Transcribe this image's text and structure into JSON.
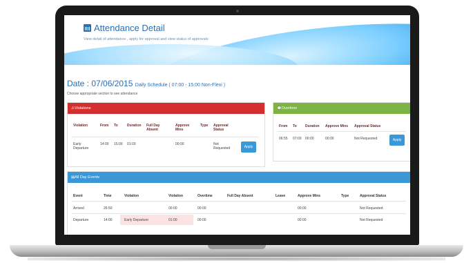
{
  "banner": {
    "title": "Attendance Detail",
    "subtitle": "View detail of attendance , apply for approval and view status of approvals"
  },
  "date": {
    "label": "Date : 07/06/2015",
    "schedule": "Daily Schedule ( 07:00 - 15:00 Non-Flexi )"
  },
  "hint": "Choose appropriate section to see attendance",
  "violations": {
    "title": "Violations",
    "header_color": "#d32f2f",
    "columns": [
      "Violation",
      "From",
      "To",
      "Duration",
      "Full Day Absent",
      "Approve Mins",
      "Type",
      "Approval Status"
    ],
    "row": {
      "violation": "Early Departure",
      "from": "14:00",
      "to": "15:00",
      "duration": "01:00",
      "full_day_absent": "",
      "approve_mins": "00:00",
      "type": "",
      "status": "Not Requested"
    },
    "apply_label": "Apply"
  },
  "overtime": {
    "title": "Overtime",
    "header_color": "#7cb342",
    "columns": [
      "From",
      "To",
      "Duration",
      "Approve Mins",
      "Approval Status"
    ],
    "row": {
      "from": "06:55",
      "to": "07:00",
      "duration": "00:00",
      "approve_mins": "00:00",
      "status": "Not Requested"
    },
    "apply_label": "Apply"
  },
  "all_day": {
    "title": "All Day Events",
    "header_color": "#3a97d8",
    "columns": [
      "Event",
      "Time",
      "Violation",
      "Violation",
      "Overtime",
      "Full Day Absent",
      "Leave",
      "Approve Mins",
      "Type",
      "Approval Status"
    ],
    "rows": [
      {
        "event": "Arrived",
        "time": "26:50",
        "violation": "",
        "violation2": "00:00",
        "overtime": "00:00",
        "full_day_absent": "",
        "leave": "",
        "approve_mins": "00:00",
        "type": "",
        "status": "Not Requested"
      },
      {
        "event": "Departure",
        "time": "14:00",
        "violation": "Early Departure",
        "violation2": "01:00",
        "overtime": "00:00",
        "full_day_absent": "",
        "leave": "",
        "approve_mins": "00:00",
        "type": "",
        "status": "Not Requested"
      }
    ]
  }
}
